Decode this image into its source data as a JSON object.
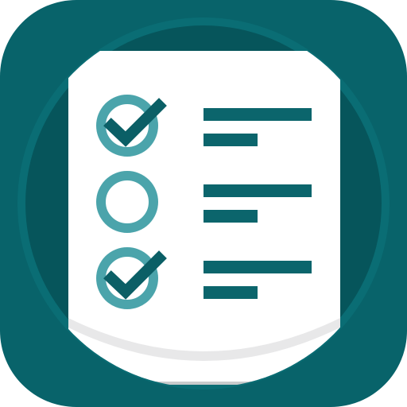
{
  "icon": {
    "name": "checklist-app-icon",
    "colors": {
      "background": "#08636a",
      "ring_outer": "#0a6b72",
      "ring_inner": "#06555b",
      "paper": "#ffffff",
      "paper_shadow": "#c9cbcc",
      "check_circle": "#4ba4ab",
      "checkmark": "#0b5f66",
      "text_line": "#0b656c"
    },
    "items": [
      {
        "checked": true
      },
      {
        "checked": false
      },
      {
        "checked": true
      }
    ]
  }
}
